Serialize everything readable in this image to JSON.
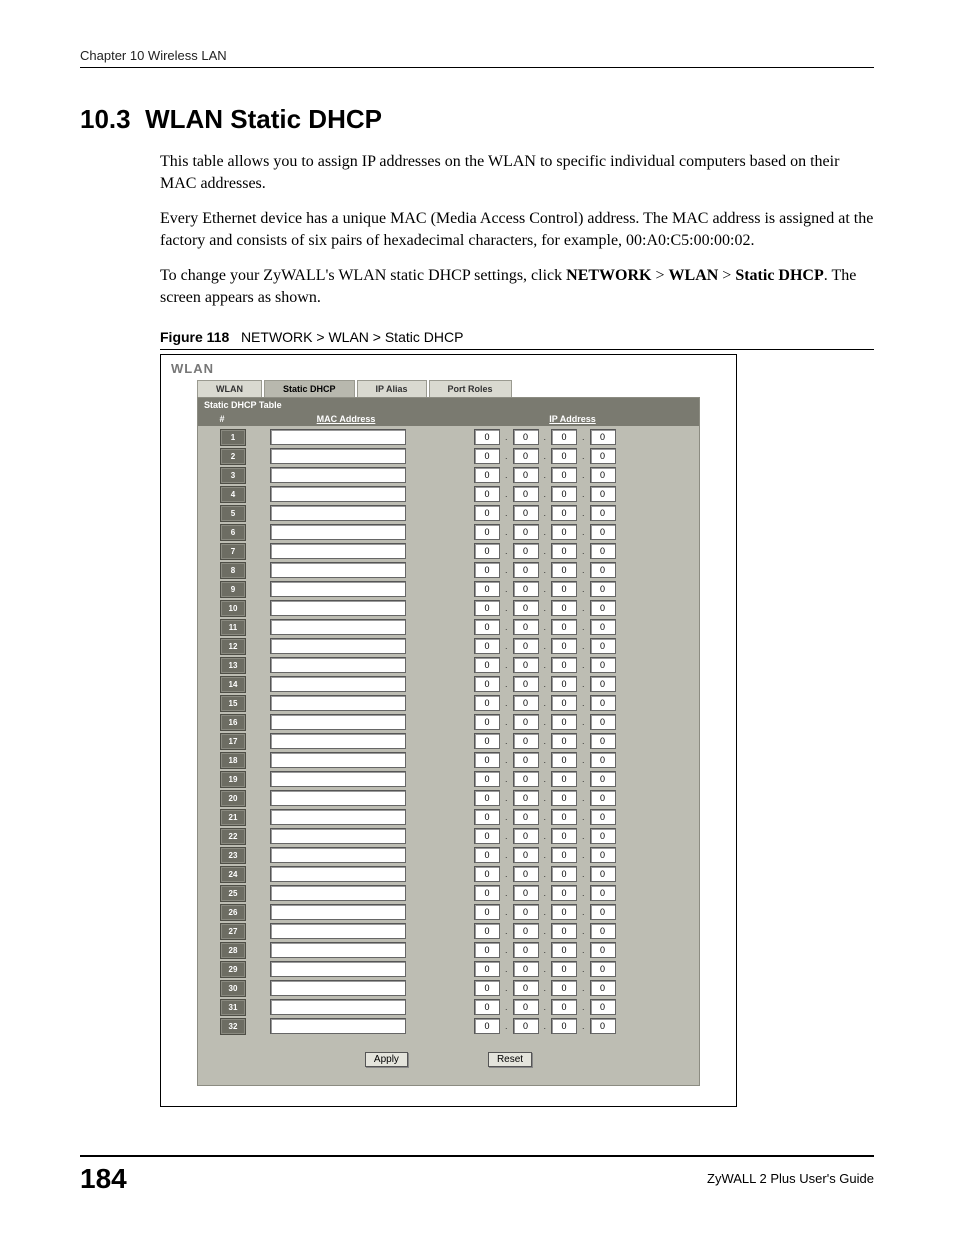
{
  "running_head": "Chapter 10 Wireless LAN",
  "section": {
    "number": "10.3",
    "title": "WLAN Static DHCP"
  },
  "paragraphs": {
    "p1": "This table allows you to assign IP addresses on the WLAN to specific individual computers based on their MAC addresses.",
    "p2": "Every Ethernet device has a unique MAC (Media Access Control) address. The MAC address is assigned at the factory and consists of six pairs of hexadecimal characters, for example, 00:A0:C5:00:00:02.",
    "p3a": "To change your ZyWALL's WLAN static DHCP settings, click ",
    "p3b": "NETWORK",
    "p3c": " > ",
    "p3d": "WLAN",
    "p3e": " > ",
    "p3f": "Static DHCP",
    "p3g": ". The screen appears as shown."
  },
  "figure": {
    "label": "Figure 118",
    "caption": "NETWORK > WLAN > Static DHCP"
  },
  "ui": {
    "window_title": "WLAN",
    "tabs": {
      "wlan": "WLAN",
      "static_dhcp": "Static DHCP",
      "ip_alias": "IP Alias",
      "port_roles": "Port Roles",
      "active": "Static DHCP"
    },
    "panel_heading": "Static DHCP Table",
    "columns": {
      "index": "#",
      "mac": "MAC Address",
      "ip": "IP Address"
    },
    "rows": [
      {
        "n": "1",
        "mac": "",
        "ip": [
          "0",
          "0",
          "0",
          "0"
        ]
      },
      {
        "n": "2",
        "mac": "",
        "ip": [
          "0",
          "0",
          "0",
          "0"
        ]
      },
      {
        "n": "3",
        "mac": "",
        "ip": [
          "0",
          "0",
          "0",
          "0"
        ]
      },
      {
        "n": "4",
        "mac": "",
        "ip": [
          "0",
          "0",
          "0",
          "0"
        ]
      },
      {
        "n": "5",
        "mac": "",
        "ip": [
          "0",
          "0",
          "0",
          "0"
        ]
      },
      {
        "n": "6",
        "mac": "",
        "ip": [
          "0",
          "0",
          "0",
          "0"
        ]
      },
      {
        "n": "7",
        "mac": "",
        "ip": [
          "0",
          "0",
          "0",
          "0"
        ]
      },
      {
        "n": "8",
        "mac": "",
        "ip": [
          "0",
          "0",
          "0",
          "0"
        ]
      },
      {
        "n": "9",
        "mac": "",
        "ip": [
          "0",
          "0",
          "0",
          "0"
        ]
      },
      {
        "n": "10",
        "mac": "",
        "ip": [
          "0",
          "0",
          "0",
          "0"
        ]
      },
      {
        "n": "11",
        "mac": "",
        "ip": [
          "0",
          "0",
          "0",
          "0"
        ]
      },
      {
        "n": "12",
        "mac": "",
        "ip": [
          "0",
          "0",
          "0",
          "0"
        ]
      },
      {
        "n": "13",
        "mac": "",
        "ip": [
          "0",
          "0",
          "0",
          "0"
        ]
      },
      {
        "n": "14",
        "mac": "",
        "ip": [
          "0",
          "0",
          "0",
          "0"
        ]
      },
      {
        "n": "15",
        "mac": "",
        "ip": [
          "0",
          "0",
          "0",
          "0"
        ]
      },
      {
        "n": "16",
        "mac": "",
        "ip": [
          "0",
          "0",
          "0",
          "0"
        ]
      },
      {
        "n": "17",
        "mac": "",
        "ip": [
          "0",
          "0",
          "0",
          "0"
        ]
      },
      {
        "n": "18",
        "mac": "",
        "ip": [
          "0",
          "0",
          "0",
          "0"
        ]
      },
      {
        "n": "19",
        "mac": "",
        "ip": [
          "0",
          "0",
          "0",
          "0"
        ]
      },
      {
        "n": "20",
        "mac": "",
        "ip": [
          "0",
          "0",
          "0",
          "0"
        ]
      },
      {
        "n": "21",
        "mac": "",
        "ip": [
          "0",
          "0",
          "0",
          "0"
        ]
      },
      {
        "n": "22",
        "mac": "",
        "ip": [
          "0",
          "0",
          "0",
          "0"
        ]
      },
      {
        "n": "23",
        "mac": "",
        "ip": [
          "0",
          "0",
          "0",
          "0"
        ]
      },
      {
        "n": "24",
        "mac": "",
        "ip": [
          "0",
          "0",
          "0",
          "0"
        ]
      },
      {
        "n": "25",
        "mac": "",
        "ip": [
          "0",
          "0",
          "0",
          "0"
        ]
      },
      {
        "n": "26",
        "mac": "",
        "ip": [
          "0",
          "0",
          "0",
          "0"
        ]
      },
      {
        "n": "27",
        "mac": "",
        "ip": [
          "0",
          "0",
          "0",
          "0"
        ]
      },
      {
        "n": "28",
        "mac": "",
        "ip": [
          "0",
          "0",
          "0",
          "0"
        ]
      },
      {
        "n": "29",
        "mac": "",
        "ip": [
          "0",
          "0",
          "0",
          "0"
        ]
      },
      {
        "n": "30",
        "mac": "",
        "ip": [
          "0",
          "0",
          "0",
          "0"
        ]
      },
      {
        "n": "31",
        "mac": "",
        "ip": [
          "0",
          "0",
          "0",
          "0"
        ]
      },
      {
        "n": "32",
        "mac": "",
        "ip": [
          "0",
          "0",
          "0",
          "0"
        ]
      }
    ],
    "buttons": {
      "apply": "Apply",
      "reset": "Reset"
    }
  },
  "footer": {
    "page_number": "184",
    "guide": "ZyWALL 2 Plus User's Guide"
  }
}
